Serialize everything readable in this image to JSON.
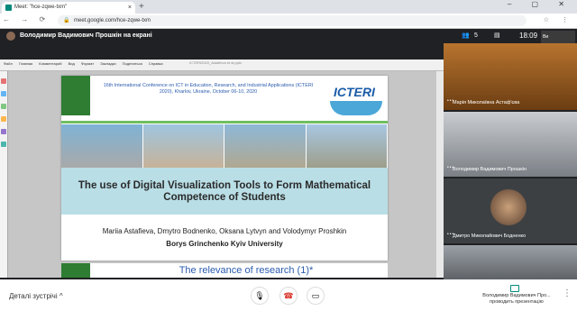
{
  "browser": {
    "tab_title": "Meet: \"hce-zqwe-txm\"",
    "tab_close": "×",
    "new_tab": "+",
    "window_controls": "– ▢ ✕",
    "nav_buttons": "← → ⟳",
    "url": "meet.google.com/hce-zqwe-txm",
    "toolbar_icons": "☆ ⋮"
  },
  "meet_top": {
    "presenter_banner": "Володимир Вадимович Прошкін на екрані",
    "participants_count": "5",
    "time": "18:09",
    "self_label": "Ви"
  },
  "presentation": {
    "ppt_menu": "Файл Главная Комментарий Вид Формат Закладки Поделиться Справка",
    "ppt_title": "ICTERI2020_Astafieva et al.pptx",
    "conference": "16th International Conference on ICT in Education, Research, and Industrial Applications (ICTERI 2020), Kharkiv, Ukraine, October 06-10, 2020",
    "logo_text": "ICTERI",
    "title": "The use of Digital Visualization Tools to Form Mathematical Competence of Students",
    "authors": "Mariia Astafieva, Dmytro Bodnenko, Oksana Lytvyn and Volodymyr Proshkin",
    "university": "Borys Grinchenko Kyiv University",
    "next_slide_title": "The relevance of research (1)*"
  },
  "participants": [
    {
      "name": "Марія Миколаївна Астаф'єва"
    },
    {
      "name": "Володимир Вадимович Прошкін"
    },
    {
      "name": "Дмитро Миколайович Бодненко"
    },
    {
      "name": ""
    }
  ],
  "bottom_bar": {
    "details": "Деталі зустрічі",
    "details_chevron": "^",
    "mic_icon": "🎙",
    "hangup_icon": "☎",
    "camera_icon": "▭",
    "presenting": "Володимир Вадимович Про... проводить презентацію",
    "more": "⋮"
  }
}
